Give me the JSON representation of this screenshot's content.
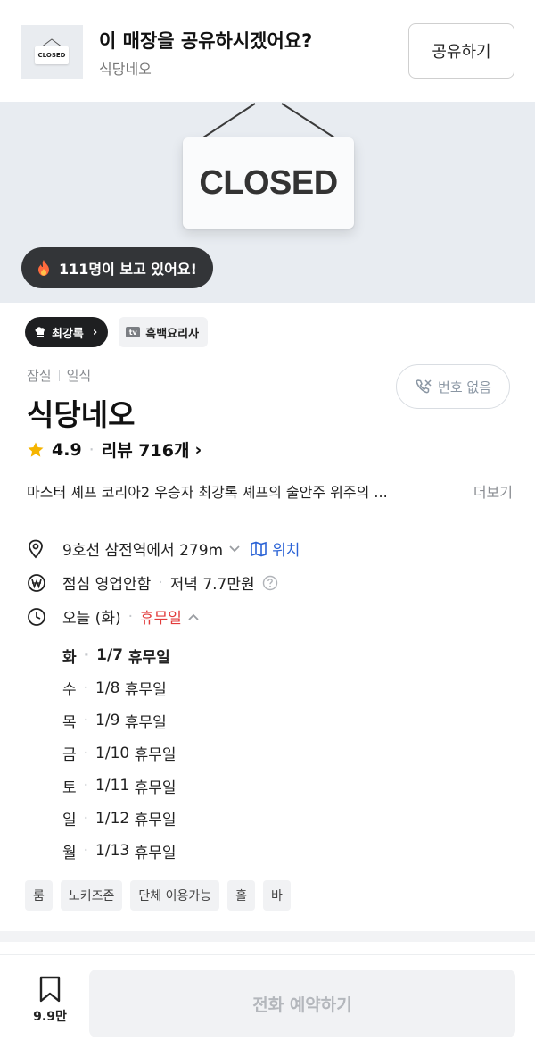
{
  "share_banner": {
    "thumb_text": "CLOSED",
    "title": "이 매장을 공유하시겠어요?",
    "subtitle": "식당네오",
    "button_label": "공유하기"
  },
  "hero": {
    "sign_text": "CLOSED",
    "viewers_text": "111명이 보고 있어요!"
  },
  "chips": {
    "chef_label": "최강록",
    "show_label": "흑백요리사",
    "show_badge": "tv"
  },
  "store": {
    "area": "잠실",
    "category": "일식",
    "name": "식당네오",
    "no_phone_label": "번호 없음",
    "rating": "4.9",
    "review_label": "리뷰 716개",
    "description": "마스터 셰프 코리아2 우승자 최강록 셰프의 술안주 위주의 ...",
    "more_label": "더보기"
  },
  "info": {
    "distance_text": "9호선 삼전역에서 279m",
    "map_label": "위치",
    "lunch_text": "점심 영업안함",
    "dinner_text": "저녁 7.7만원",
    "today_text": "오늘 (화)",
    "today_status": "휴무일"
  },
  "week_hours": [
    {
      "day": "화",
      "date": "1/7",
      "status": "휴무일"
    },
    {
      "day": "수",
      "date": "1/8",
      "status": "휴무일"
    },
    {
      "day": "목",
      "date": "1/9",
      "status": "휴무일"
    },
    {
      "day": "금",
      "date": "1/10",
      "status": "휴무일"
    },
    {
      "day": "토",
      "date": "1/11",
      "status": "휴무일"
    },
    {
      "day": "일",
      "date": "1/12",
      "status": "휴무일"
    },
    {
      "day": "월",
      "date": "1/13",
      "status": "휴무일"
    }
  ],
  "tags": [
    "룸",
    "노키즈존",
    "단체 이용가능",
    "홀",
    "바"
  ],
  "bottom_bar": {
    "bookmark_count": "9.9만",
    "call_button_label": "전화 예약하기"
  },
  "colors": {
    "accent_blue": "#2b63d6",
    "closed_red": "#e23b3b",
    "star_yellow": "#f5b400"
  }
}
